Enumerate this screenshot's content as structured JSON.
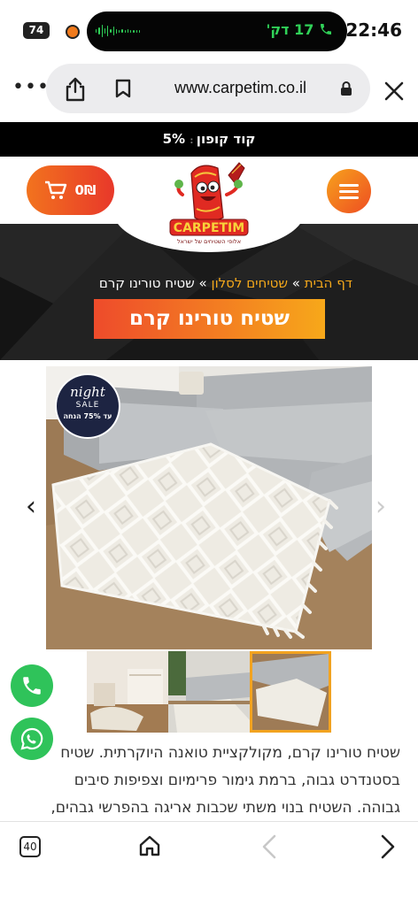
{
  "status": {
    "battery": "74",
    "call_duration": "17 דק'",
    "time": "22:46"
  },
  "browser": {
    "url": "www.carpetim.co.il",
    "more_label": "•••"
  },
  "coupon": {
    "left": "קוד קופון",
    "ghost": ": ",
    "right": "5%"
  },
  "header": {
    "cart_label": "0₪",
    "logo_name": "CARPETIM",
    "logo_tagline": "אלופי השטיחים של ישראל"
  },
  "breadcrumb": {
    "home": "דף הבית",
    "sep1": " » ",
    "category": "שטיחים לסלון",
    "sep2": " » ",
    "current": "שטיח טורינו קרם"
  },
  "product": {
    "title": "שטיח טורינו קרם",
    "badge": {
      "night": "night",
      "sale": "SALE",
      "promo": "עד 75% הנחה"
    },
    "description": [
      "שטיח טורינו קרם, מקולקציית טואנה היוקרתית. שטיח",
      "בסטנדרט גבוה, ברמת גימור פרימיום וצפיפות סיבים",
      "גבוהה. השטיח בנוי משתי שכבות אריגה בהפרשי גבהים,"
    ]
  },
  "gallery": {
    "prev": "‹",
    "next": "›",
    "thumb_count": 3,
    "selected_thumb": 3
  },
  "toolbar": {
    "tab_count": "40"
  },
  "colors": {
    "accent_orange": "#f2731e",
    "accent_red": "#e8382a",
    "whatsapp_green": "#2fc35a",
    "call_green": "#30d158"
  },
  "icons": [
    "share-icon",
    "bookmark-icon",
    "lock-icon",
    "close-icon",
    "cart-icon",
    "menu-icon",
    "phone-icon",
    "whatsapp-icon",
    "home-icon",
    "back-icon",
    "forward-icon"
  ]
}
